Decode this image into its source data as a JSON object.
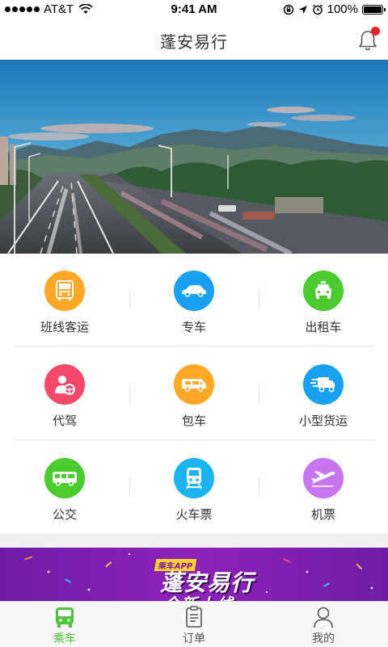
{
  "status_bar": {
    "carrier": "AT&T",
    "time": "9:41 AM",
    "battery": "100%"
  },
  "header": {
    "title": "蓬安易行"
  },
  "banner": {
    "page_count": 5,
    "active_page": 2
  },
  "services": [
    {
      "label": "班线客运",
      "icon": "bus-icon",
      "color": "#ffa726"
    },
    {
      "label": "专车",
      "icon": "car-icon",
      "color": "#1aa0f0"
    },
    {
      "label": "出租车",
      "icon": "taxi-icon",
      "color": "#4ccb2e"
    },
    {
      "label": "代驾",
      "icon": "driver-icon",
      "color": "#f5476a"
    },
    {
      "label": "包车",
      "icon": "van-icon",
      "color": "#ffa726"
    },
    {
      "label": "小型货运",
      "icon": "truck-icon",
      "color": "#1aa0f0"
    },
    {
      "label": "公交",
      "icon": "city-bus-icon",
      "color": "#4ccb2e"
    },
    {
      "label": "火车票",
      "icon": "train-icon",
      "color": "#1ab5f0"
    },
    {
      "label": "机票",
      "icon": "plane-icon",
      "color": "#c875f0"
    }
  ],
  "ad_banner": {
    "badge": "乘车APP",
    "headline": "蓬安易行",
    "subline": "全新上线"
  },
  "tabs": [
    {
      "label": "乘车",
      "icon": "bus-icon",
      "active": true
    },
    {
      "label": "订单",
      "icon": "order-icon",
      "active": false
    },
    {
      "label": "我的",
      "icon": "user-icon",
      "active": false
    }
  ],
  "colors": {
    "accent": "#4cc43a",
    "badge_red": "#e8222b",
    "ad_purple": "#8a1cb0"
  }
}
